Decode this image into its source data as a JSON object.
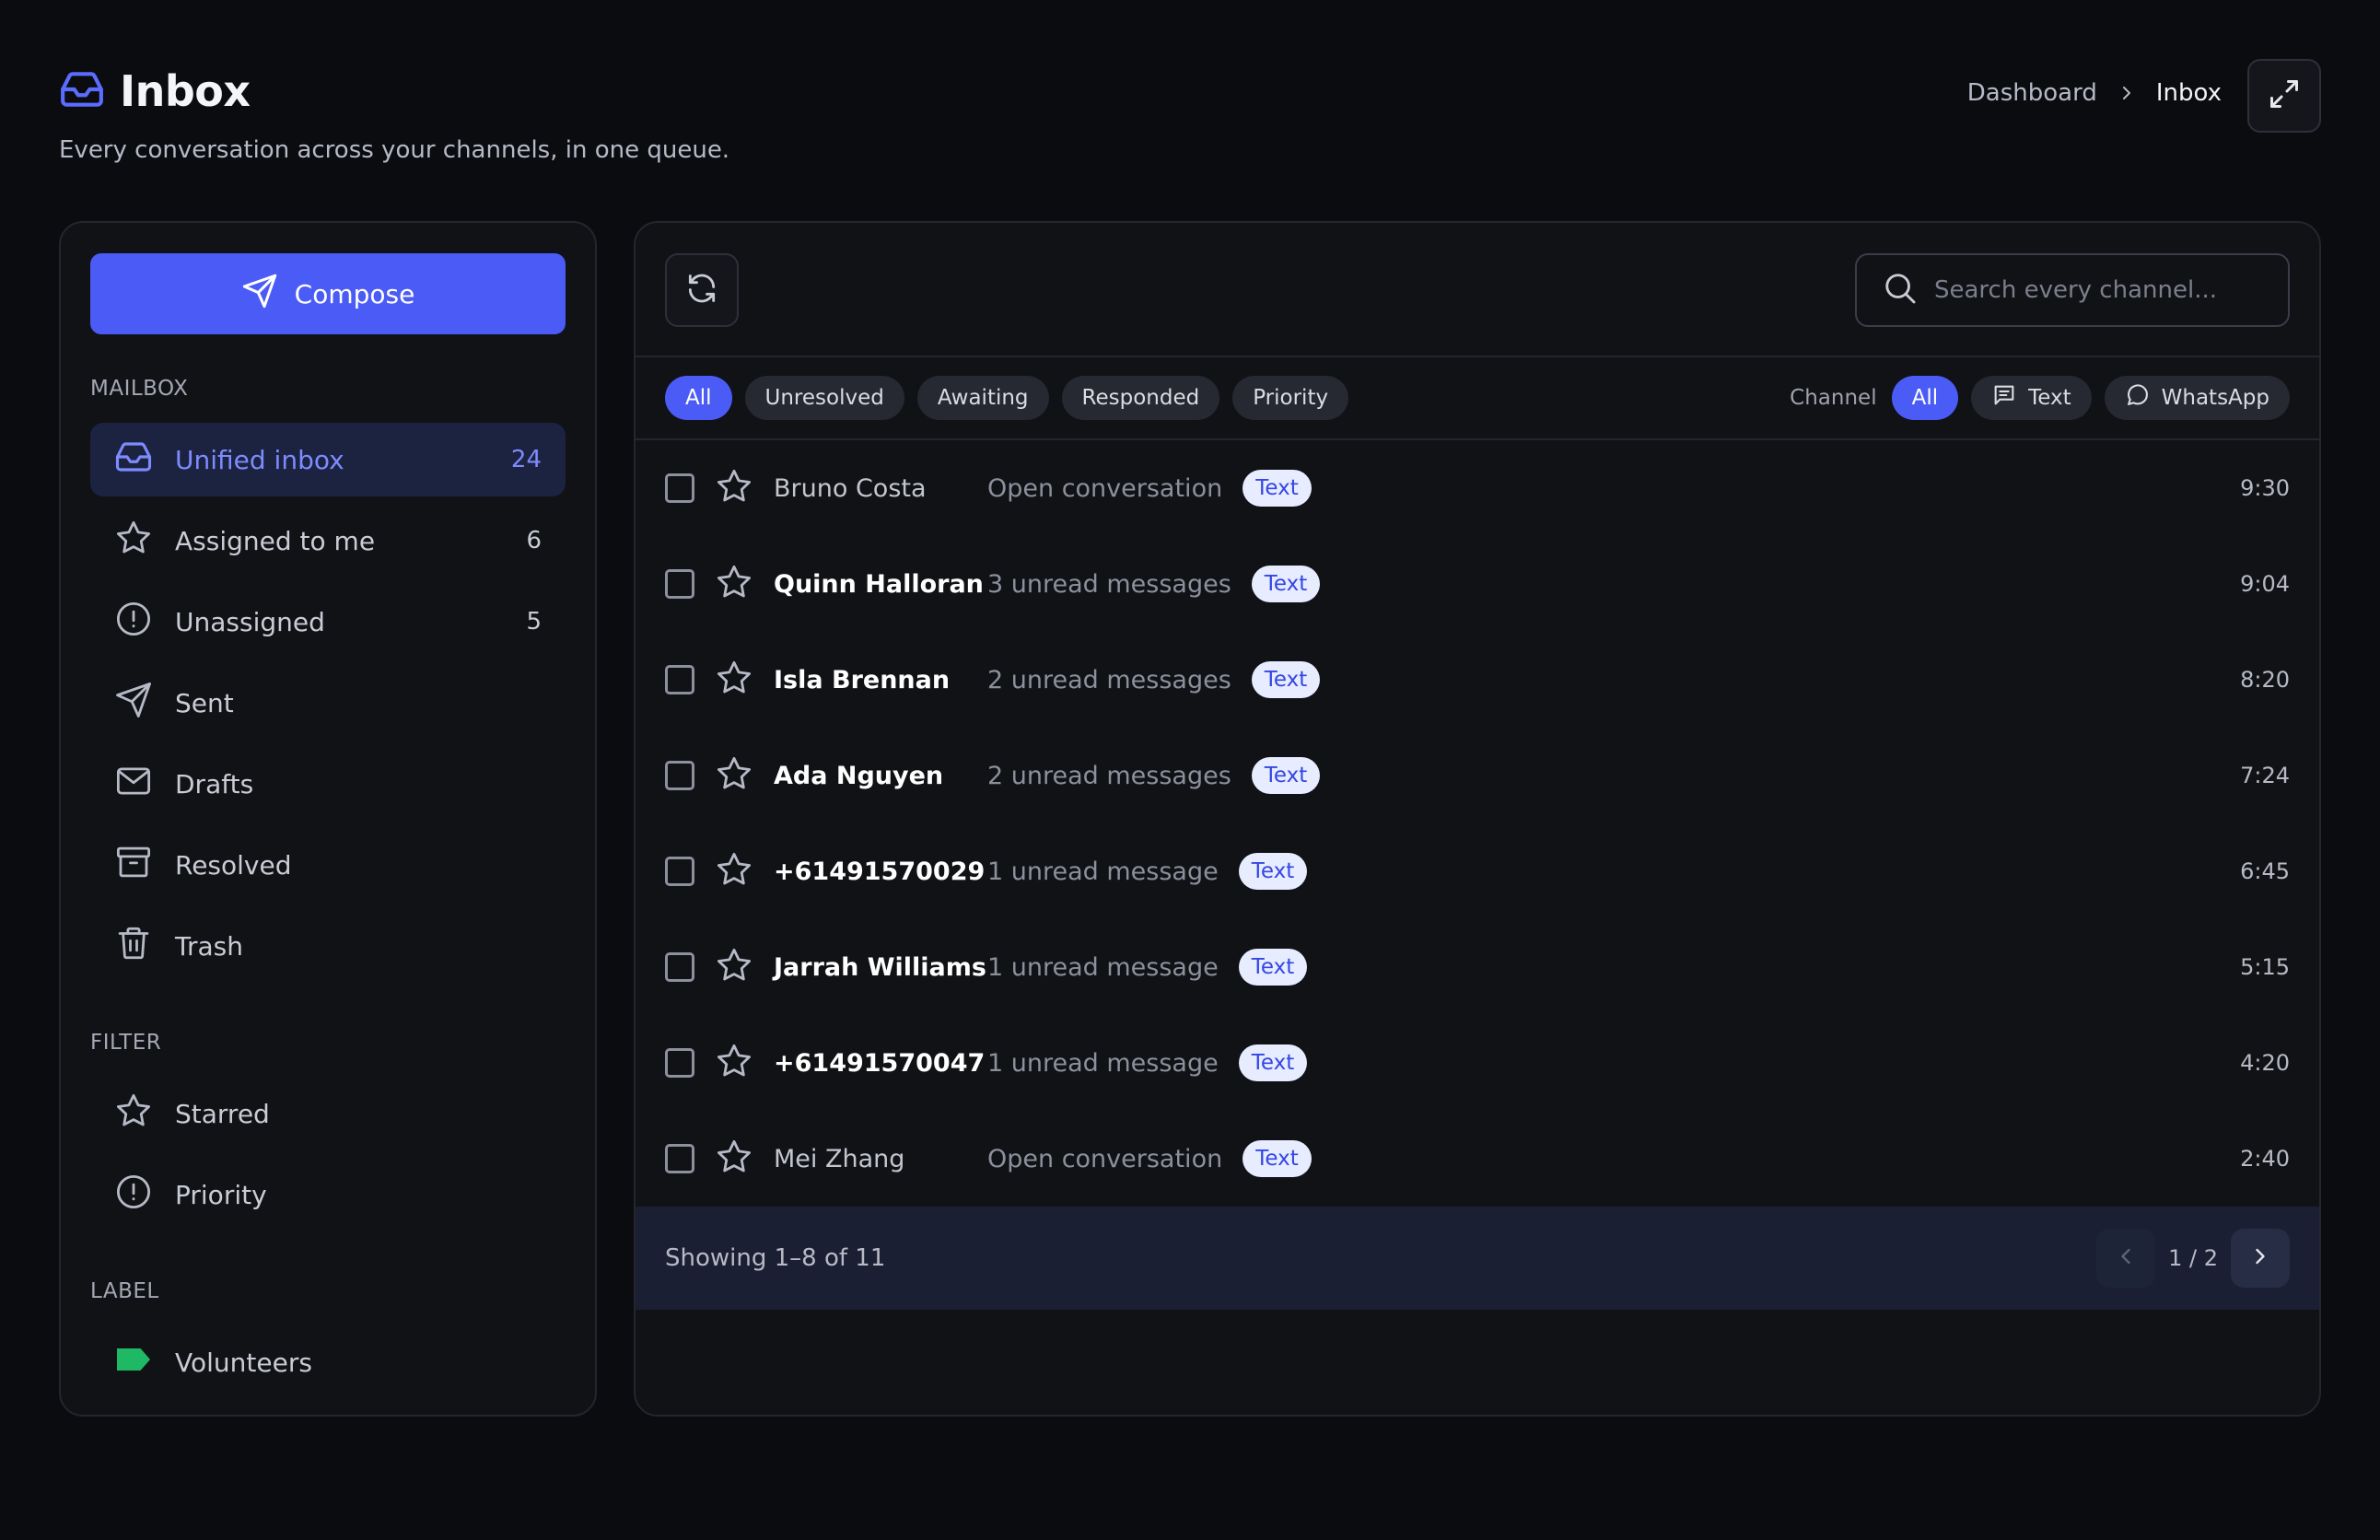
{
  "header": {
    "title": "Inbox",
    "subtitle": "Every conversation across your channels, in one queue.",
    "breadcrumb": [
      "Dashboard",
      "Inbox"
    ]
  },
  "colors": {
    "accent": "#4b5cf6",
    "background": "#0b0c10",
    "panel": "#111216",
    "badge_bg": "#e7ecff",
    "badge_text": "#3446e6",
    "label_volunteers": "#1fb865"
  },
  "sidebar": {
    "compose_label": "Compose",
    "mailbox_heading": "MAILBOX",
    "mailbox": [
      {
        "label": "Unified inbox",
        "count": "24",
        "icon": "inbox-icon",
        "active": true
      },
      {
        "label": "Assigned to me",
        "count": "6",
        "icon": "star-icon"
      },
      {
        "label": "Unassigned",
        "count": "5",
        "icon": "alert-circle-icon"
      },
      {
        "label": "Sent",
        "count": "",
        "icon": "send-icon"
      },
      {
        "label": "Drafts",
        "count": "",
        "icon": "mail-icon"
      },
      {
        "label": "Resolved",
        "count": "",
        "icon": "archive-icon"
      },
      {
        "label": "Trash",
        "count": "",
        "icon": "trash-icon"
      }
    ],
    "filter_heading": "FILTER",
    "filters": [
      {
        "label": "Starred",
        "icon": "star-icon"
      },
      {
        "label": "Priority",
        "icon": "alert-circle-icon"
      }
    ],
    "label_heading": "LABEL",
    "labels": [
      {
        "label": "Volunteers",
        "icon": "tag-icon"
      }
    ]
  },
  "toolbar": {
    "search_placeholder": "Search every channel..."
  },
  "status_filters": [
    {
      "label": "All",
      "active": true
    },
    {
      "label": "Unresolved"
    },
    {
      "label": "Awaiting"
    },
    {
      "label": "Responded"
    },
    {
      "label": "Priority"
    }
  ],
  "channel_filter": {
    "label": "Channel",
    "options": [
      {
        "label": "All",
        "active": true
      },
      {
        "label": "Text",
        "icon": "message-square-icon"
      },
      {
        "label": "WhatsApp",
        "icon": "message-circle-icon"
      }
    ]
  },
  "conversations": [
    {
      "sender": "Bruno Costa",
      "preview": "Open conversation",
      "channel": "Text",
      "time": "9:30",
      "unread": false
    },
    {
      "sender": "Quinn Halloran",
      "preview": "3 unread messages",
      "channel": "Text",
      "time": "9:04",
      "unread": true
    },
    {
      "sender": "Isla Brennan",
      "preview": "2 unread messages",
      "channel": "Text",
      "time": "8:20",
      "unread": true
    },
    {
      "sender": "Ada Nguyen",
      "preview": "2 unread messages",
      "channel": "Text",
      "time": "7:24",
      "unread": true
    },
    {
      "sender": "+61491570029",
      "preview": "1 unread message",
      "channel": "Text",
      "time": "6:45",
      "unread": true
    },
    {
      "sender": "Jarrah Williams",
      "preview": "1 unread message",
      "channel": "Text",
      "time": "5:15",
      "unread": true
    },
    {
      "sender": "+61491570047",
      "preview": "1 unread message",
      "channel": "Text",
      "time": "4:20",
      "unread": true
    },
    {
      "sender": "Mei Zhang",
      "preview": "Open conversation",
      "channel": "Text",
      "time": "2:40",
      "unread": false
    }
  ],
  "footer": {
    "showing": "Showing 1–8 of 11",
    "page": "1 / 2"
  }
}
